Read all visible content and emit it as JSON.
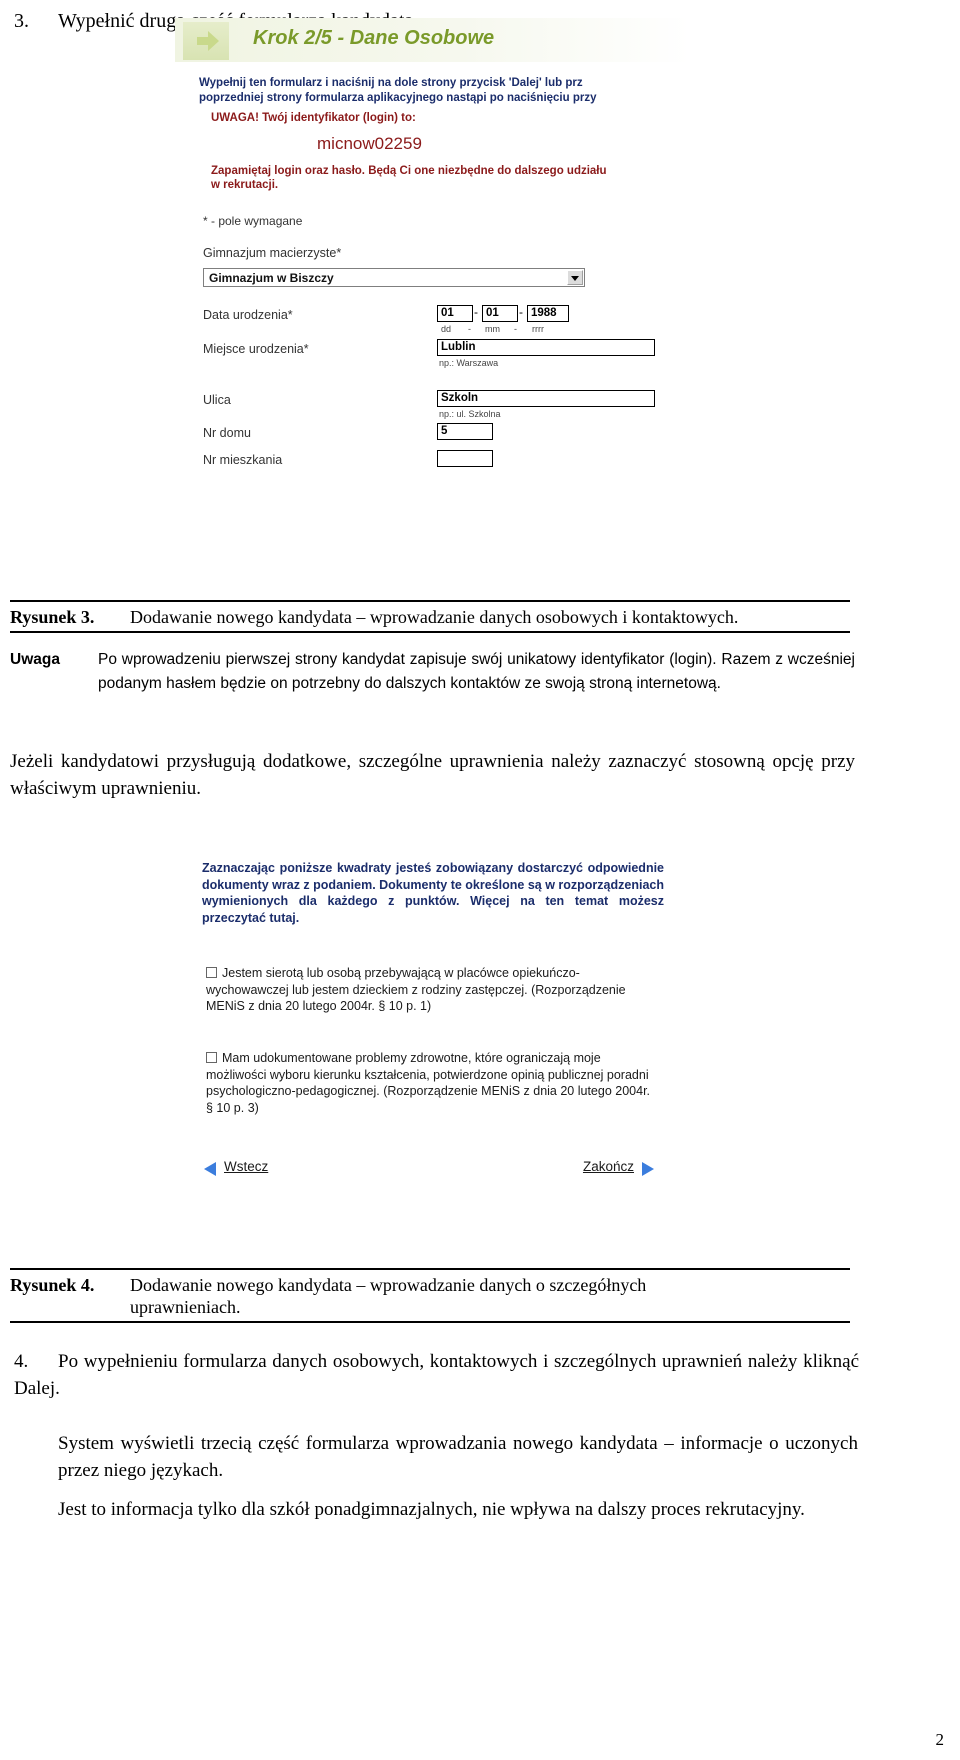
{
  "document": {
    "page_number": "2",
    "step3": {
      "number": "3.",
      "text": "Wypełnić drugą część formularza kandydata."
    },
    "step4": {
      "number": "4.",
      "text": "Po wypełnieniu formularza danych osobowych, kontaktowych i szczególnych uprawnień należy kliknąć  Dalej."
    },
    "paragraph_special": "Jeżeli kandydatowi przysługują dodatkowe, szczególne uprawnienia należy zaznaczyć stosowną opcję przy właściwym uprawnieniu.",
    "paragraph_system": "System wyświetli trzecią część formularza wprowadzania nowego kandydata – informacje o uczonych przez niego językach.",
    "paragraph_info": "Jest to informacja tylko dla szkół ponadgimnazjalnych, nie wpływa na dalszy proces rekrutacyjny."
  },
  "note": {
    "label": "Uwaga",
    "text": "Po wprowadzeniu pierwszej strony kandydat zapisuje swój unikatowy identyfikator (login). Razem z wcześniej podanym hasłem będzie on potrzebny do dalszych kontaktów ze swoją stroną internetową."
  },
  "figure3": {
    "caption_label": "Rysunek 3.",
    "caption_text": "Dodawanie nowego kandydata – wprowadzanie danych osobowych i kontaktowych.",
    "screenshot": {
      "header_title": "Krok 2/5 - Dane Osobowe",
      "intro_line1": "Wypełnij ten formularz i naciśnij na dole strony przycisk 'Dalej' lub prz",
      "intro_line2": "poprzedniej strony formularza aplikacyjnego nastąpi po naciśnięciu przy",
      "uwaga_login_label": "UWAGA! Twój identyfikator (login) to:",
      "login_value": "micnow02259",
      "remember_text": "Zapamiętaj login oraz hasło. Będą Ci one niezbędne do dalszego udziału w rekrutacji.",
      "required_note": "* - pole wymagane",
      "fields": {
        "school_label": "Gimnazjum macierzyste*",
        "school_value": "Gimnazjum w Biszczy",
        "birth_date_label": "Data urodzenia*",
        "birth_day": "01",
        "birth_month": "01",
        "birth_year": "1988",
        "date_hint_dd": "dd",
        "date_hint_mm": "mm",
        "date_hint_rrrr": "rrrr",
        "date_sep": "-",
        "birth_place_label": "Miejsce urodzenia*",
        "birth_place_value": "Lublin",
        "birth_place_hint": "np.: Warszawa",
        "street_label": "Ulica",
        "street_value": "Szkoln",
        "street_hint": "np.: ul. Szkolna",
        "house_label": "Nr domu",
        "house_value": "5",
        "flat_label": "Nr mieszkania",
        "flat_value": ""
      }
    }
  },
  "figure4": {
    "caption_label": "Rysunek 4.",
    "caption_text": "Dodawanie nowego kandydata – wprowadzanie danych o szczegółnych",
    "caption_text2": "uprawnieniach.",
    "screenshot": {
      "notice": "Zaznaczając poniższe kwadraty jesteś zobowiązany dostarczyć odpowiednie dokumenty wraz z podaniem. Dokumenty te określone są w rozporządzeniach wymienionych dla każdego z punktów. Więcej na ten temat możesz przeczytać tutaj.",
      "checkboxes": [
        {
          "checked": false,
          "label": "Jestem sierotą lub osobą przebywającą w placówce opiekuńczo-wychowawczej lub jestem dzieckiem z rodziny zastępczej. (Rozporządzenie MENiS z dnia 20 lutego 2004r. § 10 p. 1)"
        },
        {
          "checked": false,
          "label": "Mam udokumentowane problemy zdrowotne, które ograniczają moje możliwości wyboru kierunku kształcenia, potwierdzone opinią publicznej poradni psychologiczno-pedagogicznej. (Rozporządzenie MENiS z dnia 20 lutego 2004r. § 10 p. 3)"
        }
      ],
      "nav_back": "Wstecz",
      "nav_finish": "Zakończ"
    }
  },
  "colors": {
    "header_green": "#7a9a2a",
    "blue_text": "#1b2d6b",
    "red_text": "#8b1a1a",
    "nav_blue": "#3b7ddd"
  }
}
